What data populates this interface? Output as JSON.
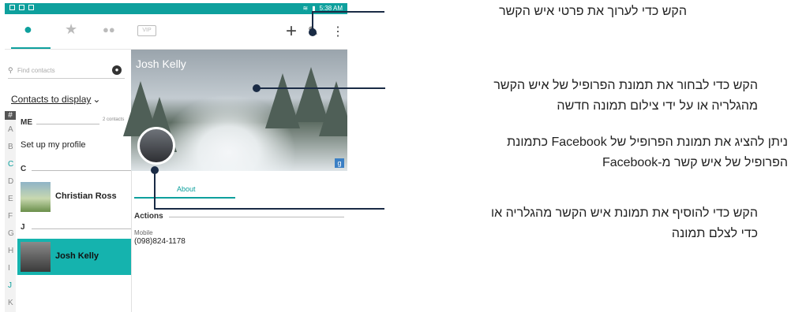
{
  "status_bar": {
    "time": "5:38 AM"
  },
  "toolbar": {
    "tab_contacts_icon": "person-icon",
    "tab_favorites_icon": "star-icon",
    "tab_groups_icon": "group-icon",
    "tab_vip_label": "VIP",
    "add_icon": "plus-icon",
    "edit_icon": "pencil-icon",
    "more_icon": "more-vertical-icon"
  },
  "contacts": {
    "search_placeholder": "Find contacts",
    "display_label": "Contacts to display",
    "index_letters": [
      "#",
      "A",
      "B",
      "C",
      "D",
      "E",
      "F",
      "G",
      "H",
      "I",
      "J",
      "K"
    ],
    "me_header": "ME",
    "me_count": "2 contacts",
    "setup_profile": "Set up my profile",
    "sections": [
      {
        "letter": "C",
        "name": "Christian Ross"
      },
      {
        "letter": "J",
        "name": "Josh Kelly"
      }
    ]
  },
  "detail": {
    "name": "Josh Kelly",
    "tab_about": "About",
    "actions_header": "Actions",
    "mobile_label": "Mobile",
    "mobile_number": "(098)824-1178",
    "gplus": "g"
  },
  "annotations": {
    "edit": "הקש כדי לערוך את פרטי איש הקשר",
    "cover_1": "הקש כדי לבחור את תמונת הפרופיל של איש הקשר",
    "cover_2": "מהגלריה או על ידי צילום תמונה חדשה",
    "facebook_1": "ניתן להציג את תמונת הפרופיל של Facebook כתמונת",
    "facebook_2": "הפרופיל של איש קשר מ-Facebook",
    "photo_1": "הקש כדי להוסיף את תמונת איש הקשר מהגלריה או",
    "photo_2": "כדי לצלם תמונה"
  },
  "colors": {
    "accent": "#0ea09d",
    "selected_row": "#15b3ae",
    "callout": "#1a2b45"
  }
}
